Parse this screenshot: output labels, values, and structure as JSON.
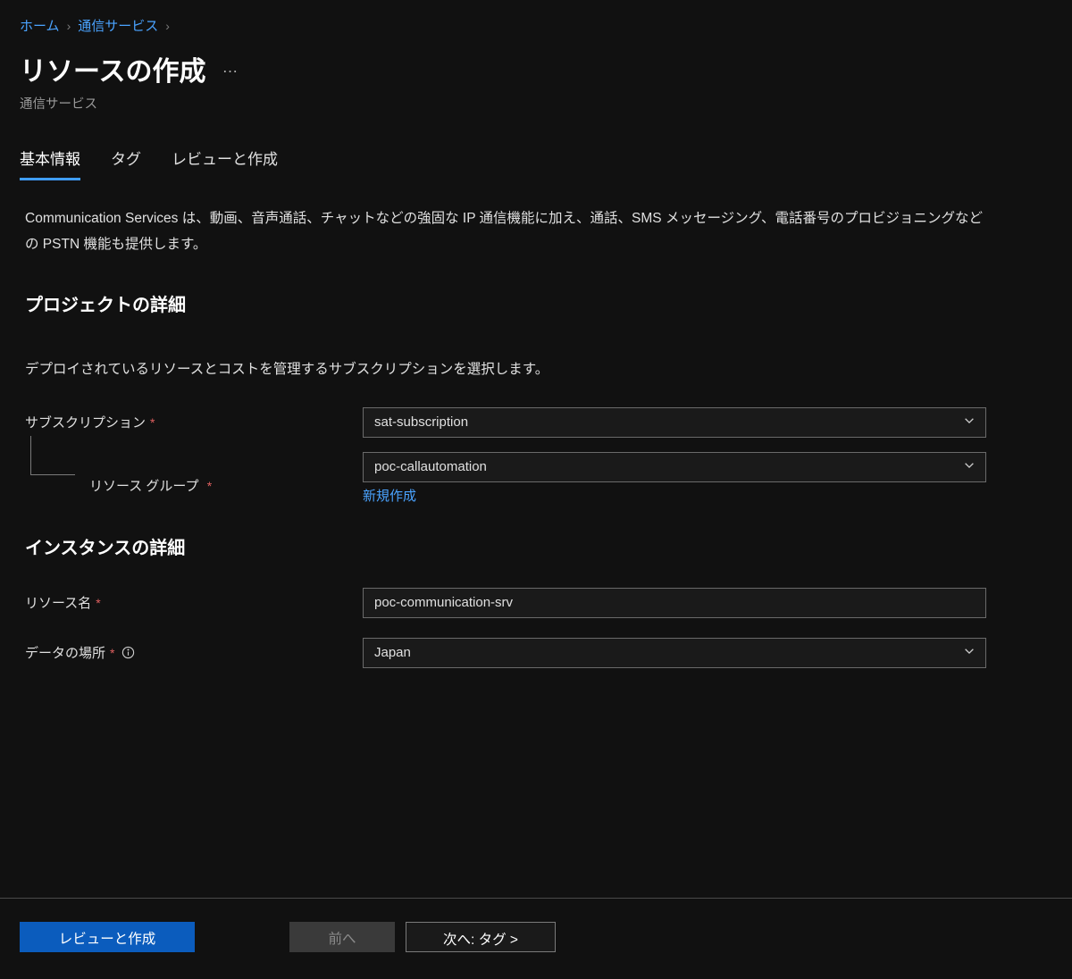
{
  "breadcrumb": {
    "home": "ホーム",
    "service": "通信サービス"
  },
  "header": {
    "title": "リソースの作成",
    "subtitle": "通信サービス"
  },
  "tabs": {
    "basic": "基本情報",
    "tags": "タグ",
    "review": "レビューと作成"
  },
  "intro": "Communication Services は、動画、音声通話、チャットなどの強固な IP 通信機能に加え、通話、SMS メッセージング、電話番号のプロビジョニングなどの PSTN 機能も提供します。",
  "project": {
    "heading": "プロジェクトの詳細",
    "description": "デプロイされているリソースとコストを管理するサブスクリプションを選択します。",
    "subscription_label": "サブスクリプション",
    "subscription_value": "sat-subscription",
    "resource_group_label": "リソース グループ",
    "resource_group_value": "poc-callautomation",
    "create_new": "新規作成"
  },
  "instance": {
    "heading": "インスタンスの詳細",
    "resource_name_label": "リソース名",
    "resource_name_value": "poc-communication-srv",
    "data_location_label": "データの場所",
    "data_location_value": "Japan"
  },
  "footer": {
    "review": "レビューと作成",
    "previous": "前へ",
    "next": "次へ: タグ >"
  }
}
